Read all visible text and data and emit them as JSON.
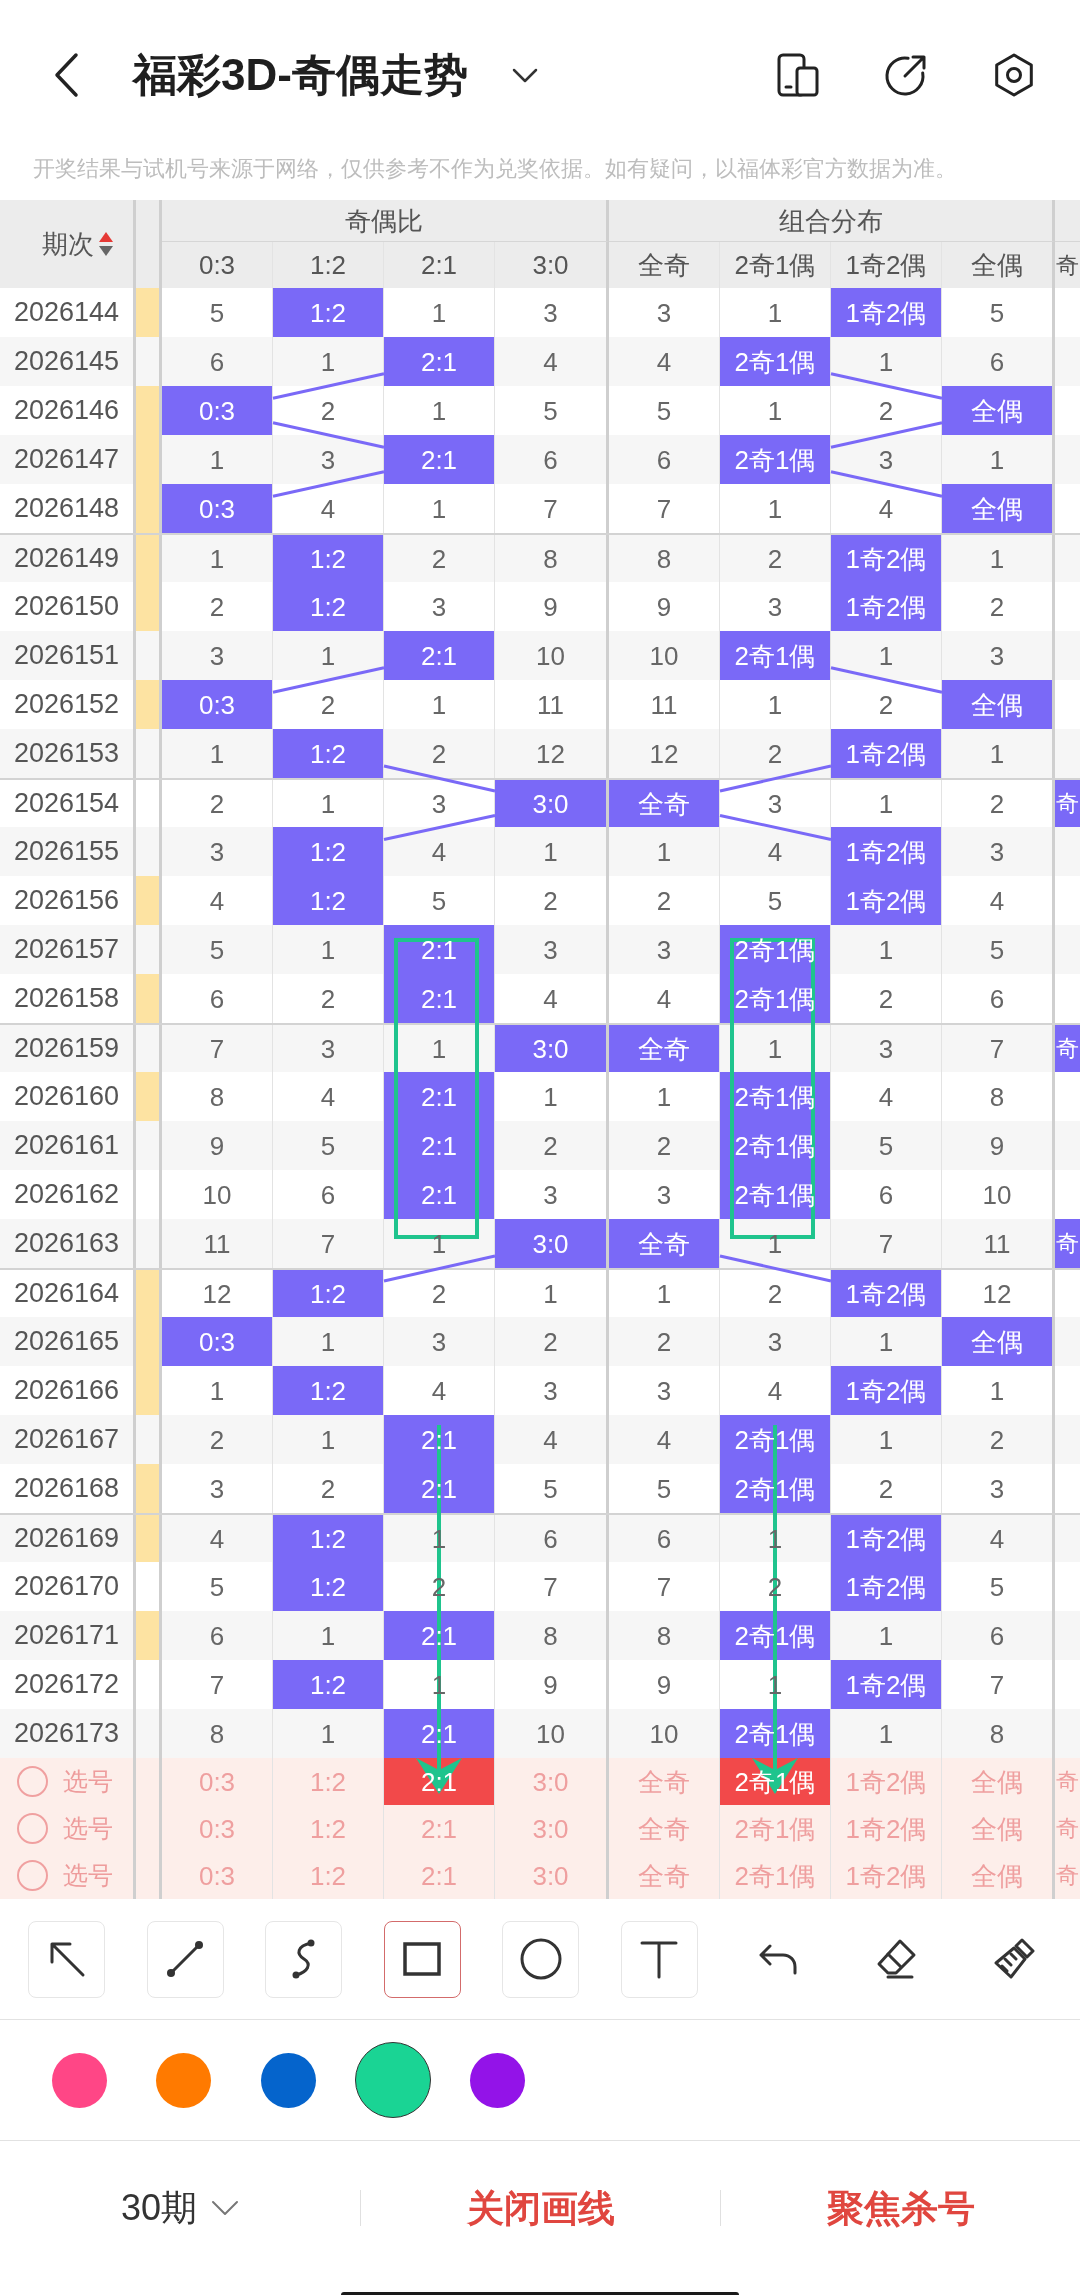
{
  "header": {
    "title": "福彩3D-奇偶走势"
  },
  "notice": "开奖结果与试机号来源于网络，仅供参考不作为兑奖依据。如有疑问，以福体彩官方数据为准。",
  "table": {
    "issue_heading": "期次",
    "sort": {
      "ascending": true
    },
    "groups": [
      {
        "title": "奇偶比",
        "columns": [
          "0:3",
          "1:2",
          "2:1",
          "3:0"
        ]
      },
      {
        "title": "组合分布",
        "columns": [
          "全奇",
          "2奇1偶",
          "1奇2偶",
          "全偶"
        ]
      },
      {
        "columns": [
          "奇"
        ]
      }
    ],
    "rows": [
      {
        "issue": "2026144",
        "marked": true,
        "cells": [
          {
            "text": "5",
            "hit": false
          },
          {
            "text": "1:2",
            "hit": true
          },
          {
            "text": "1",
            "hit": false
          },
          {
            "text": "3",
            "hit": false
          },
          {
            "text": "3",
            "hit": false
          },
          {
            "text": "1",
            "hit": false
          },
          {
            "text": "1奇2偶",
            "hit": true
          },
          {
            "text": "5",
            "hit": false
          }
        ]
      },
      {
        "issue": "2026145",
        "marked": false,
        "cells": [
          {
            "text": "6",
            "hit": false
          },
          {
            "text": "1",
            "hit": false
          },
          {
            "text": "2:1",
            "hit": true
          },
          {
            "text": "4",
            "hit": false
          },
          {
            "text": "4",
            "hit": false
          },
          {
            "text": "2奇1偶",
            "hit": true
          },
          {
            "text": "1",
            "hit": false
          },
          {
            "text": "6",
            "hit": false
          }
        ]
      },
      {
        "issue": "2026146",
        "marked": true,
        "cells": [
          {
            "text": "0:3",
            "hit": true
          },
          {
            "text": "2",
            "hit": false
          },
          {
            "text": "1",
            "hit": false
          },
          {
            "text": "5",
            "hit": false
          },
          {
            "text": "5",
            "hit": false
          },
          {
            "text": "1",
            "hit": false
          },
          {
            "text": "2",
            "hit": false
          },
          {
            "text": "全偶",
            "hit": true
          }
        ]
      },
      {
        "issue": "2026147",
        "marked": true,
        "cells": [
          {
            "text": "1",
            "hit": false
          },
          {
            "text": "3",
            "hit": false
          },
          {
            "text": "2:1",
            "hit": true
          },
          {
            "text": "6",
            "hit": false
          },
          {
            "text": "6",
            "hit": false
          },
          {
            "text": "2奇1偶",
            "hit": true
          },
          {
            "text": "3",
            "hit": false
          },
          {
            "text": "1",
            "hit": false
          }
        ]
      },
      {
        "issue": "2026148",
        "marked": true,
        "cells": [
          {
            "text": "0:3",
            "hit": true
          },
          {
            "text": "4",
            "hit": false
          },
          {
            "text": "1",
            "hit": false
          },
          {
            "text": "7",
            "hit": false
          },
          {
            "text": "7",
            "hit": false
          },
          {
            "text": "1",
            "hit": false
          },
          {
            "text": "4",
            "hit": false
          },
          {
            "text": "全偶",
            "hit": true
          }
        ]
      },
      {
        "issue": "2026149",
        "marked": true,
        "cells": [
          {
            "text": "1",
            "hit": false
          },
          {
            "text": "1:2",
            "hit": true
          },
          {
            "text": "2",
            "hit": false
          },
          {
            "text": "8",
            "hit": false
          },
          {
            "text": "8",
            "hit": false
          },
          {
            "text": "2",
            "hit": false
          },
          {
            "text": "1奇2偶",
            "hit": true
          },
          {
            "text": "1",
            "hit": false
          }
        ]
      },
      {
        "issue": "2026150",
        "marked": true,
        "cells": [
          {
            "text": "2",
            "hit": false
          },
          {
            "text": "1:2",
            "hit": true
          },
          {
            "text": "3",
            "hit": false
          },
          {
            "text": "9",
            "hit": false
          },
          {
            "text": "9",
            "hit": false
          },
          {
            "text": "3",
            "hit": false
          },
          {
            "text": "1奇2偶",
            "hit": true
          },
          {
            "text": "2",
            "hit": false
          }
        ]
      },
      {
        "issue": "2026151",
        "marked": false,
        "cells": [
          {
            "text": "3",
            "hit": false
          },
          {
            "text": "1",
            "hit": false
          },
          {
            "text": "2:1",
            "hit": true
          },
          {
            "text": "10",
            "hit": false
          },
          {
            "text": "10",
            "hit": false
          },
          {
            "text": "2奇1偶",
            "hit": true
          },
          {
            "text": "1",
            "hit": false
          },
          {
            "text": "3",
            "hit": false
          }
        ]
      },
      {
        "issue": "2026152",
        "marked": true,
        "cells": [
          {
            "text": "0:3",
            "hit": true
          },
          {
            "text": "2",
            "hit": false
          },
          {
            "text": "1",
            "hit": false
          },
          {
            "text": "11",
            "hit": false
          },
          {
            "text": "11",
            "hit": false
          },
          {
            "text": "1",
            "hit": false
          },
          {
            "text": "2",
            "hit": false
          },
          {
            "text": "全偶",
            "hit": true
          }
        ]
      },
      {
        "issue": "2026153",
        "marked": false,
        "cells": [
          {
            "text": "1",
            "hit": false
          },
          {
            "text": "1:2",
            "hit": true
          },
          {
            "text": "2",
            "hit": false
          },
          {
            "text": "12",
            "hit": false
          },
          {
            "text": "12",
            "hit": false
          },
          {
            "text": "2",
            "hit": false
          },
          {
            "text": "1奇2偶",
            "hit": true
          },
          {
            "text": "1",
            "hit": false
          }
        ]
      },
      {
        "issue": "2026154",
        "marked": false,
        "cells": [
          {
            "text": "2",
            "hit": false
          },
          {
            "text": "1",
            "hit": false
          },
          {
            "text": "3",
            "hit": false
          },
          {
            "text": "3:0",
            "hit": true
          },
          {
            "text": "全奇",
            "hit": true
          },
          {
            "text": "3",
            "hit": false
          },
          {
            "text": "1",
            "hit": false
          },
          {
            "text": "2",
            "hit": false
          },
          {
            "text": "奇",
            "hit": true
          }
        ]
      },
      {
        "issue": "2026155",
        "marked": false,
        "cells": [
          {
            "text": "3",
            "hit": false
          },
          {
            "text": "1:2",
            "hit": true
          },
          {
            "text": "4",
            "hit": false
          },
          {
            "text": "1",
            "hit": false
          },
          {
            "text": "1",
            "hit": false
          },
          {
            "text": "4",
            "hit": false
          },
          {
            "text": "1奇2偶",
            "hit": true
          },
          {
            "text": "3",
            "hit": false
          }
        ]
      },
      {
        "issue": "2026156",
        "marked": true,
        "cells": [
          {
            "text": "4",
            "hit": false
          },
          {
            "text": "1:2",
            "hit": true
          },
          {
            "text": "5",
            "hit": false
          },
          {
            "text": "2",
            "hit": false
          },
          {
            "text": "2",
            "hit": false
          },
          {
            "text": "5",
            "hit": false
          },
          {
            "text": "1奇2偶",
            "hit": true
          },
          {
            "text": "4",
            "hit": false
          }
        ]
      },
      {
        "issue": "2026157",
        "marked": false,
        "cells": [
          {
            "text": "5",
            "hit": false
          },
          {
            "text": "1",
            "hit": false
          },
          {
            "text": "2:1",
            "hit": true
          },
          {
            "text": "3",
            "hit": false
          },
          {
            "text": "3",
            "hit": false
          },
          {
            "text": "2奇1偶",
            "hit": true
          },
          {
            "text": "1",
            "hit": false
          },
          {
            "text": "5",
            "hit": false
          }
        ]
      },
      {
        "issue": "2026158",
        "marked": true,
        "cells": [
          {
            "text": "6",
            "hit": false
          },
          {
            "text": "2",
            "hit": false
          },
          {
            "text": "2:1",
            "hit": true
          },
          {
            "text": "4",
            "hit": false
          },
          {
            "text": "4",
            "hit": false
          },
          {
            "text": "2奇1偶",
            "hit": true
          },
          {
            "text": "2",
            "hit": false
          },
          {
            "text": "6",
            "hit": false
          }
        ]
      },
      {
        "issue": "2026159",
        "marked": false,
        "cells": [
          {
            "text": "7",
            "hit": false
          },
          {
            "text": "3",
            "hit": false
          },
          {
            "text": "1",
            "hit": false
          },
          {
            "text": "3:0",
            "hit": true
          },
          {
            "text": "全奇",
            "hit": true
          },
          {
            "text": "1",
            "hit": false
          },
          {
            "text": "3",
            "hit": false
          },
          {
            "text": "7",
            "hit": false
          },
          {
            "text": "奇",
            "hit": true
          }
        ]
      },
      {
        "issue": "2026160",
        "marked": true,
        "cells": [
          {
            "text": "8",
            "hit": false
          },
          {
            "text": "4",
            "hit": false
          },
          {
            "text": "2:1",
            "hit": true
          },
          {
            "text": "1",
            "hit": false
          },
          {
            "text": "1",
            "hit": false
          },
          {
            "text": "2奇1偶",
            "hit": true
          },
          {
            "text": "4",
            "hit": false
          },
          {
            "text": "8",
            "hit": false
          }
        ]
      },
      {
        "issue": "2026161",
        "marked": false,
        "cells": [
          {
            "text": "9",
            "hit": false
          },
          {
            "text": "5",
            "hit": false
          },
          {
            "text": "2:1",
            "hit": true
          },
          {
            "text": "2",
            "hit": false
          },
          {
            "text": "2",
            "hit": false
          },
          {
            "text": "2奇1偶",
            "hit": true
          },
          {
            "text": "5",
            "hit": false
          },
          {
            "text": "9",
            "hit": false
          }
        ]
      },
      {
        "issue": "2026162",
        "marked": false,
        "cells": [
          {
            "text": "10",
            "hit": false
          },
          {
            "text": "6",
            "hit": false
          },
          {
            "text": "2:1",
            "hit": true
          },
          {
            "text": "3",
            "hit": false
          },
          {
            "text": "3",
            "hit": false
          },
          {
            "text": "2奇1偶",
            "hit": true
          },
          {
            "text": "6",
            "hit": false
          },
          {
            "text": "10",
            "hit": false
          }
        ]
      },
      {
        "issue": "2026163",
        "marked": false,
        "cells": [
          {
            "text": "11",
            "hit": false
          },
          {
            "text": "7",
            "hit": false
          },
          {
            "text": "1",
            "hit": false
          },
          {
            "text": "3:0",
            "hit": true
          },
          {
            "text": "全奇",
            "hit": true
          },
          {
            "text": "1",
            "hit": false
          },
          {
            "text": "7",
            "hit": false
          },
          {
            "text": "11",
            "hit": false
          },
          {
            "text": "奇",
            "hit": true
          }
        ]
      },
      {
        "issue": "2026164",
        "marked": true,
        "cells": [
          {
            "text": "12",
            "hit": false
          },
          {
            "text": "1:2",
            "hit": true
          },
          {
            "text": "2",
            "hit": false
          },
          {
            "text": "1",
            "hit": false
          },
          {
            "text": "1",
            "hit": false
          },
          {
            "text": "2",
            "hit": false
          },
          {
            "text": "1奇2偶",
            "hit": true
          },
          {
            "text": "12",
            "hit": false
          }
        ]
      },
      {
        "issue": "2026165",
        "marked": true,
        "cells": [
          {
            "text": "0:3",
            "hit": true
          },
          {
            "text": "1",
            "hit": false
          },
          {
            "text": "3",
            "hit": false
          },
          {
            "text": "2",
            "hit": false
          },
          {
            "text": "2",
            "hit": false
          },
          {
            "text": "3",
            "hit": false
          },
          {
            "text": "1",
            "hit": false
          },
          {
            "text": "全偶",
            "hit": true
          }
        ]
      },
      {
        "issue": "2026166",
        "marked": true,
        "cells": [
          {
            "text": "1",
            "hit": false
          },
          {
            "text": "1:2",
            "hit": true
          },
          {
            "text": "4",
            "hit": false
          },
          {
            "text": "3",
            "hit": false
          },
          {
            "text": "3",
            "hit": false
          },
          {
            "text": "4",
            "hit": false
          },
          {
            "text": "1奇2偶",
            "hit": true
          },
          {
            "text": "1",
            "hit": false
          }
        ]
      },
      {
        "issue": "2026167",
        "marked": false,
        "cells": [
          {
            "text": "2",
            "hit": false
          },
          {
            "text": "1",
            "hit": false
          },
          {
            "text": "2:1",
            "hit": true
          },
          {
            "text": "4",
            "hit": false
          },
          {
            "text": "4",
            "hit": false
          },
          {
            "text": "2奇1偶",
            "hit": true
          },
          {
            "text": "1",
            "hit": false
          },
          {
            "text": "2",
            "hit": false
          }
        ]
      },
      {
        "issue": "2026168",
        "marked": true,
        "cells": [
          {
            "text": "3",
            "hit": false
          },
          {
            "text": "2",
            "hit": false
          },
          {
            "text": "2:1",
            "hit": true
          },
          {
            "text": "5",
            "hit": false
          },
          {
            "text": "5",
            "hit": false
          },
          {
            "text": "2奇1偶",
            "hit": true
          },
          {
            "text": "2",
            "hit": false
          },
          {
            "text": "3",
            "hit": false
          }
        ]
      },
      {
        "issue": "2026169",
        "marked": true,
        "cells": [
          {
            "text": "4",
            "hit": false
          },
          {
            "text": "1:2",
            "hit": true
          },
          {
            "text": "1",
            "hit": false
          },
          {
            "text": "6",
            "hit": false
          },
          {
            "text": "6",
            "hit": false
          },
          {
            "text": "1",
            "hit": false
          },
          {
            "text": "1奇2偶",
            "hit": true
          },
          {
            "text": "4",
            "hit": false
          }
        ]
      },
      {
        "issue": "2026170",
        "marked": false,
        "cells": [
          {
            "text": "5",
            "hit": false
          },
          {
            "text": "1:2",
            "hit": true
          },
          {
            "text": "2",
            "hit": false
          },
          {
            "text": "7",
            "hit": false
          },
          {
            "text": "7",
            "hit": false
          },
          {
            "text": "2",
            "hit": false
          },
          {
            "text": "1奇2偶",
            "hit": true
          },
          {
            "text": "5",
            "hit": false
          }
        ]
      },
      {
        "issue": "2026171",
        "marked": true,
        "cells": [
          {
            "text": "6",
            "hit": false
          },
          {
            "text": "1",
            "hit": false
          },
          {
            "text": "2:1",
            "hit": true
          },
          {
            "text": "8",
            "hit": false
          },
          {
            "text": "8",
            "hit": false
          },
          {
            "text": "2奇1偶",
            "hit": true
          },
          {
            "text": "1",
            "hit": false
          },
          {
            "text": "6",
            "hit": false
          }
        ]
      },
      {
        "issue": "2026172",
        "marked": false,
        "cells": [
          {
            "text": "7",
            "hit": false
          },
          {
            "text": "1:2",
            "hit": true
          },
          {
            "text": "1",
            "hit": false
          },
          {
            "text": "9",
            "hit": false
          },
          {
            "text": "9",
            "hit": false
          },
          {
            "text": "1",
            "hit": false
          },
          {
            "text": "1奇2偶",
            "hit": true
          },
          {
            "text": "7",
            "hit": false
          }
        ]
      },
      {
        "issue": "2026173",
        "marked": false,
        "cells": [
          {
            "text": "8",
            "hit": false
          },
          {
            "text": "1",
            "hit": false
          },
          {
            "text": "2:1",
            "hit": true
          },
          {
            "text": "10",
            "hit": false
          },
          {
            "text": "10",
            "hit": false
          },
          {
            "text": "2奇1偶",
            "hit": true
          },
          {
            "text": "1",
            "hit": false
          },
          {
            "text": "8",
            "hit": false
          }
        ]
      }
    ],
    "pick_rows": [
      {
        "label": "选号",
        "checked": false,
        "cells": [
          {
            "text": "0:3",
            "selected": false
          },
          {
            "text": "1:2",
            "selected": false
          },
          {
            "text": "2:1",
            "selected": true
          },
          {
            "text": "3:0",
            "selected": false
          },
          {
            "text": "全奇",
            "selected": false
          },
          {
            "text": "2奇1偶",
            "selected": true
          },
          {
            "text": "1奇2偶",
            "selected": false
          },
          {
            "text": "全偶",
            "selected": false
          },
          {
            "text": "奇",
            "selected": false
          }
        ]
      },
      {
        "label": "选号",
        "checked": false,
        "cells": [
          {
            "text": "0:3",
            "selected": false
          },
          {
            "text": "1:2",
            "selected": false
          },
          {
            "text": "2:1",
            "selected": false
          },
          {
            "text": "3:0",
            "selected": false
          },
          {
            "text": "全奇",
            "selected": false
          },
          {
            "text": "2奇1偶",
            "selected": false
          },
          {
            "text": "1奇2偶",
            "selected": false
          },
          {
            "text": "全偶",
            "selected": false
          },
          {
            "text": "奇",
            "selected": false
          }
        ]
      },
      {
        "label": "选号",
        "checked": false,
        "cells": [
          {
            "text": "0:3",
            "selected": false
          },
          {
            "text": "1:2",
            "selected": false
          },
          {
            "text": "2:1",
            "selected": false
          },
          {
            "text": "3:0",
            "selected": false
          },
          {
            "text": "全奇",
            "selected": false
          },
          {
            "text": "2奇1偶",
            "selected": false
          },
          {
            "text": "1奇2偶",
            "selected": false
          },
          {
            "text": "全偶",
            "selected": false
          },
          {
            "text": "奇",
            "selected": false
          }
        ]
      }
    ]
  },
  "annotations": [
    {
      "kind": "rectangle"
    },
    {
      "kind": "rectangle"
    },
    {
      "kind": "arrow"
    },
    {
      "kind": "arrow"
    }
  ],
  "tools": [
    {
      "selected": false
    },
    {
      "selected": false
    },
    {
      "selected": false
    },
    {
      "selected": true
    },
    {
      "selected": false
    },
    {
      "selected": false
    }
  ],
  "colors": [
    {
      "color": "#ff4686",
      "selected": false
    },
    {
      "color": "#ff7a00",
      "selected": false
    },
    {
      "color": "#0564cc",
      "selected": false
    },
    {
      "color": "#1ad494",
      "selected": true
    },
    {
      "color": "#9313e8",
      "selected": false
    }
  ],
  "footer": {
    "period": "30期",
    "actions": [
      "关闭画线",
      "聚焦杀号"
    ]
  }
}
